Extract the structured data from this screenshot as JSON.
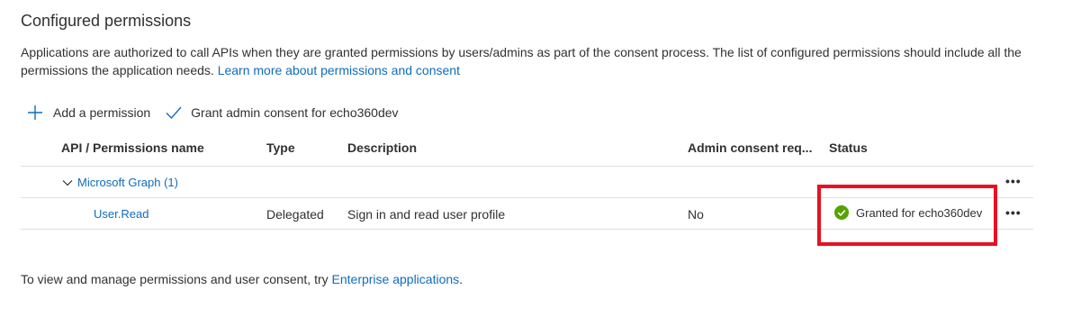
{
  "section": {
    "title": "Configured permissions",
    "description": "Applications are authorized to call APIs when they are granted permissions by users/admins as part of the consent process. The list of configured permissions should include all the permissions the application needs.",
    "learn_more_link": "Learn more about permissions and consent"
  },
  "toolbar": {
    "add_permission": "Add a permission",
    "grant_consent": "Grant admin consent for echo360dev"
  },
  "table": {
    "columns": [
      "API / Permissions name",
      "Type",
      "Description",
      "Admin consent req...",
      "Status"
    ],
    "group": {
      "name": "Microsoft Graph (1)",
      "more": "•••"
    },
    "rows": [
      {
        "name": "User.Read",
        "type": "Delegated",
        "description": "Sign in and read user profile",
        "admin_consent": "No",
        "status": "Granted for echo360dev",
        "more": "•••"
      }
    ]
  },
  "footer": {
    "text": "To view and manage permissions and user consent, try",
    "link": "Enterprise applications",
    "suffix": "."
  },
  "icons": {
    "add": "plus-icon",
    "grant": "checkmark-icon",
    "expand": "chevron-down-icon",
    "status": "check-circle-icon"
  },
  "colors": {
    "link": "#0f6cbd",
    "success": "#57a300",
    "highlight": "#e81123"
  }
}
